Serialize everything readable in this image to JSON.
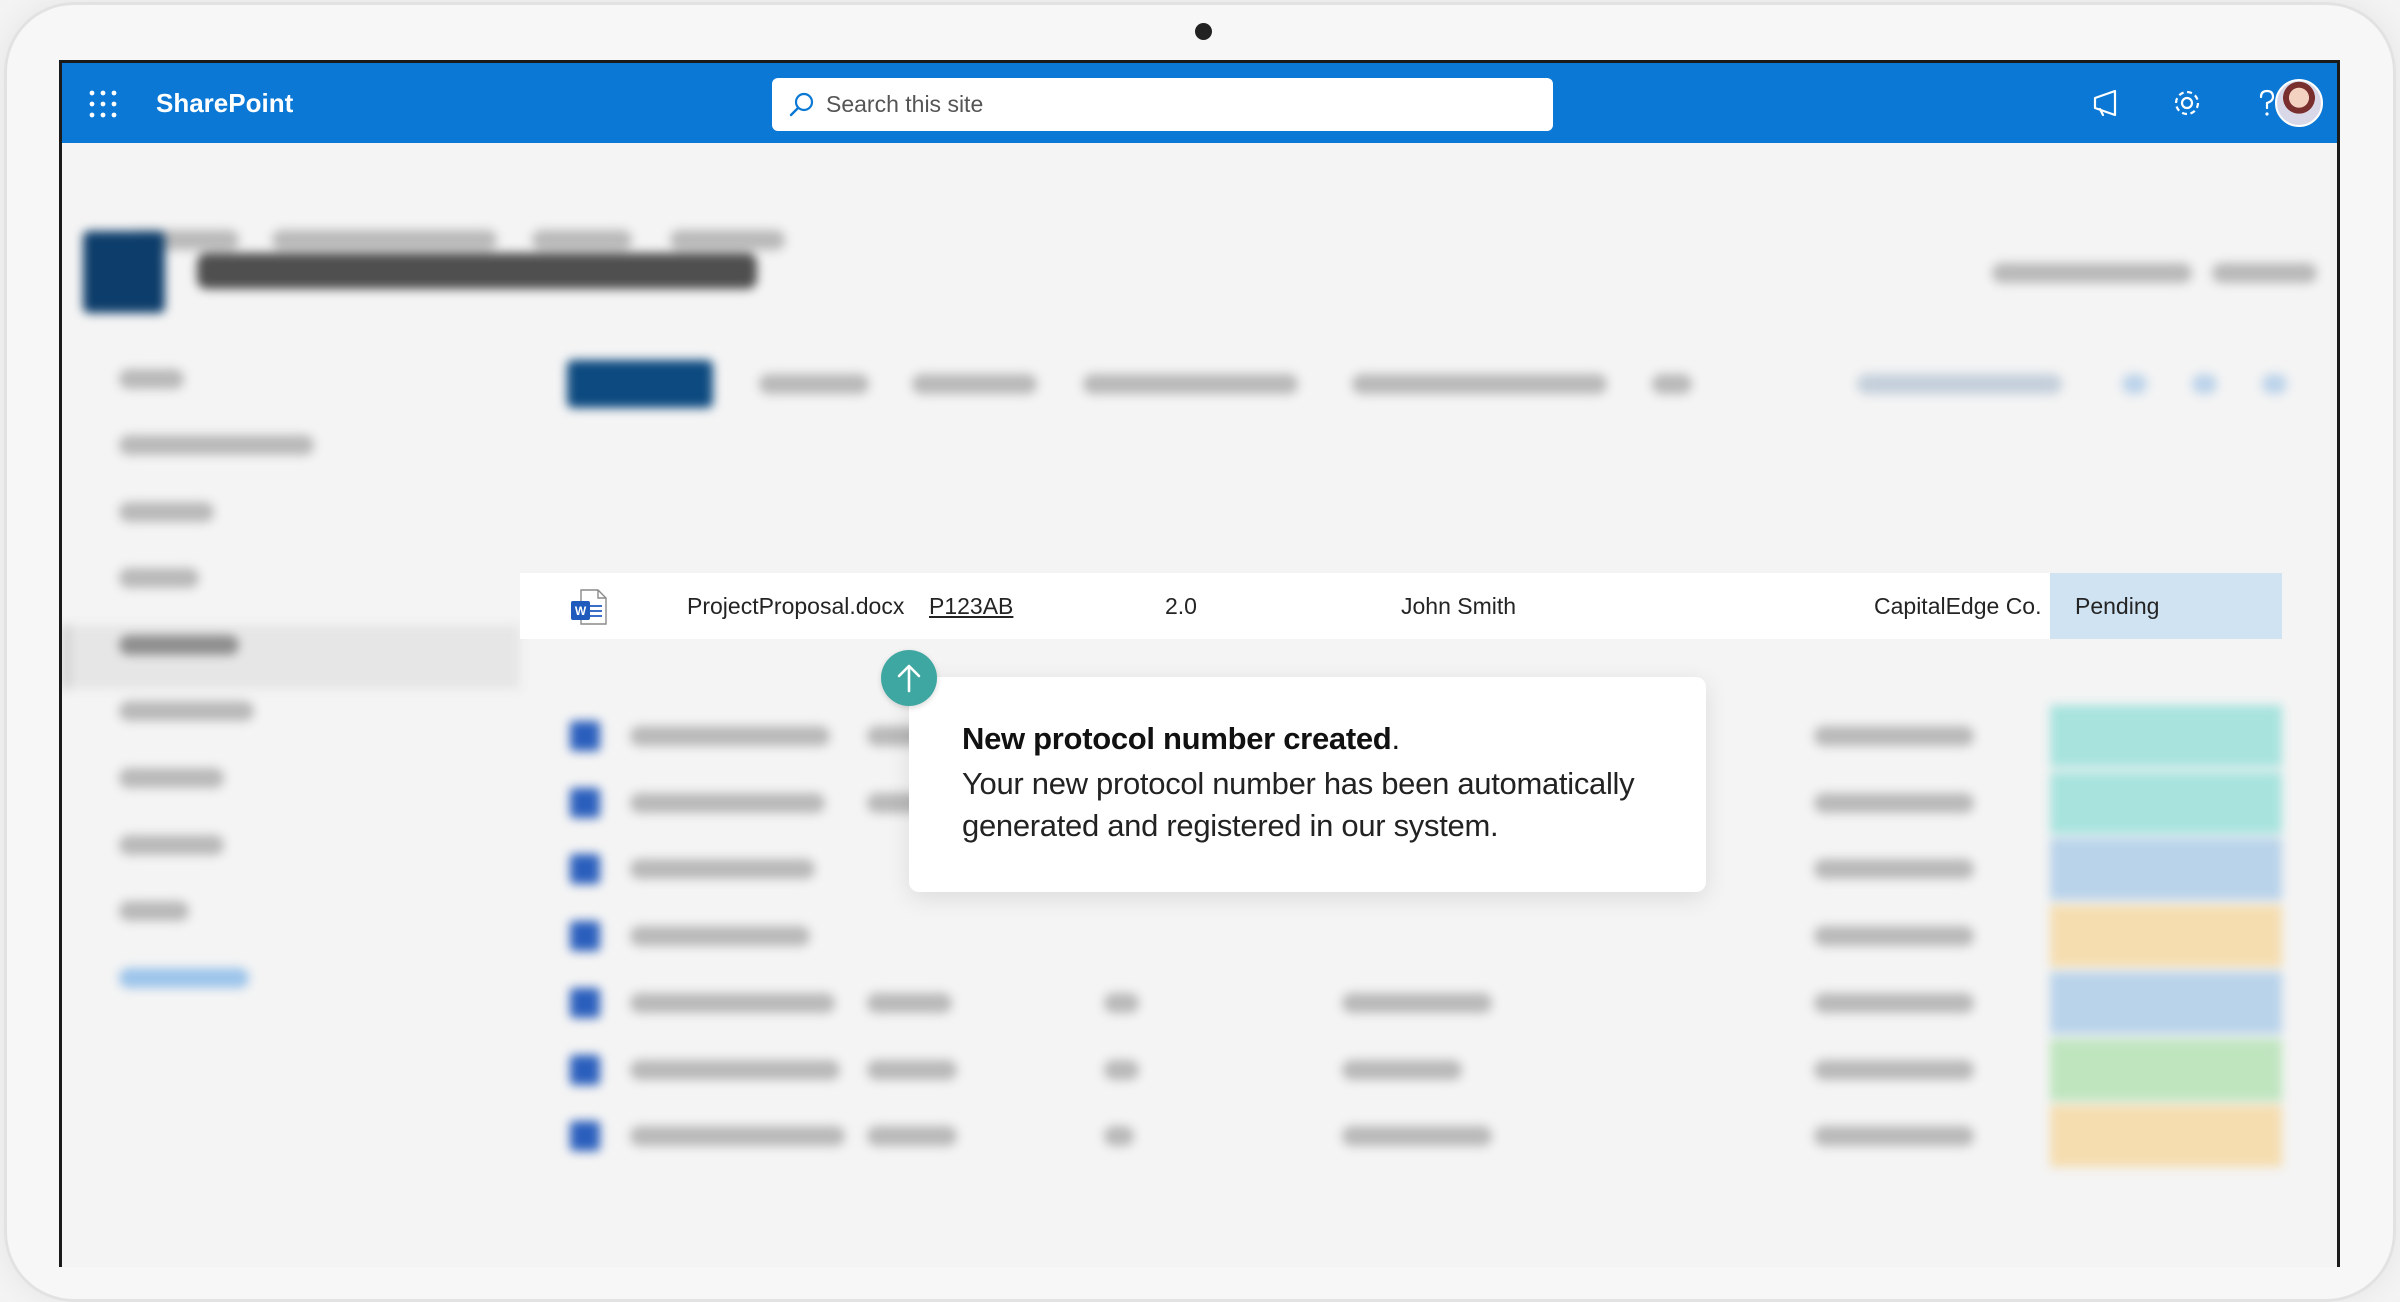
{
  "app": {
    "brand": "SharePoint",
    "search_placeholder": "Search this site"
  },
  "topbar_icons": [
    "megaphone-icon",
    "gear-icon",
    "help-icon",
    "user-avatar"
  ],
  "focused_row": {
    "name": "ProjectProposal.docx",
    "code": "P123AB",
    "version": "2.0",
    "editor": "John Smith",
    "approver": "CapitalEdge Co.",
    "status": "Pending"
  },
  "callout": {
    "title": "New protocol number created",
    "title_suffix": ".",
    "body": "Your new protocol number has been automatically generated and registered in our system."
  },
  "colors": {
    "suitebar": "#0a78d4",
    "status_pending": "#cfe3f3",
    "status_progress": "#a8e3de",
    "status_draft": "#f5ddb0",
    "status_approved": "#bfe5bf",
    "link": "#d6348a",
    "pointer": "#3ea7a1"
  }
}
